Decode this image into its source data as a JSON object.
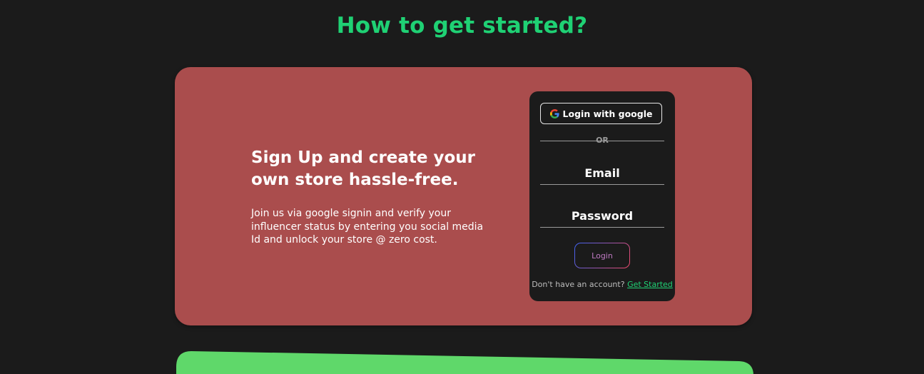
{
  "section": {
    "heading": "How to get started?"
  },
  "card": {
    "title": "Sign Up and create your own store hassle-free.",
    "description": "Join us via google signin and verify your influencer status by entering you social media Id and unlock your store @ zero cost."
  },
  "login": {
    "google_button_label": "Login with google",
    "google_icon": "google-icon",
    "divider_text": "OR",
    "email_label": "Email",
    "password_label": "Password",
    "login_button_label": "Login",
    "signup_prompt": "Don't have an account?",
    "signup_link": "Get Started"
  },
  "colors": {
    "background": "#1b1b1b",
    "heading": "#1fd174",
    "card": "#aa4d4d",
    "next_card": "#5fd86a"
  }
}
